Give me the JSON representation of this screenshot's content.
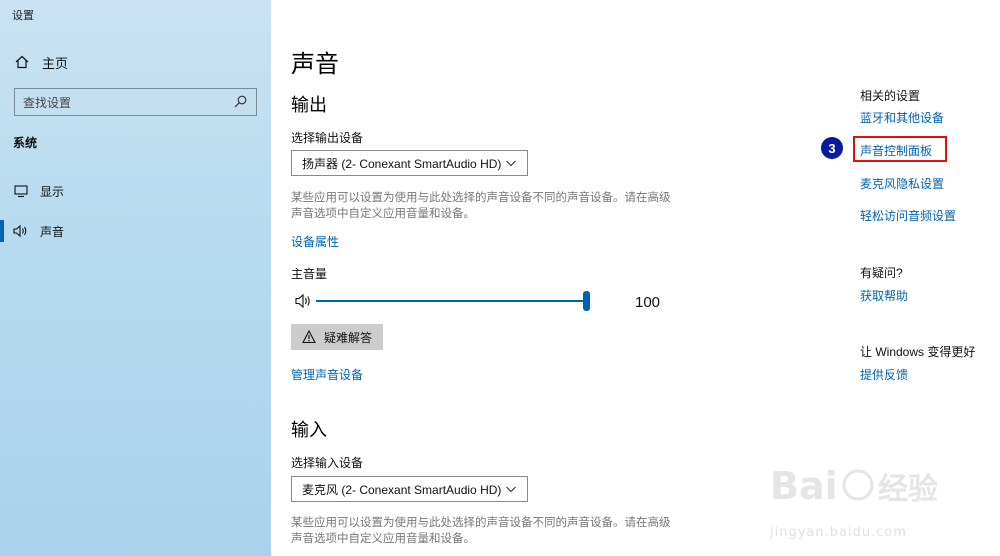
{
  "window": {
    "title": "设置"
  },
  "sidebar": {
    "home_label": "主页",
    "search_placeholder": "查找设置",
    "section": "系统",
    "items": [
      {
        "label": "显示",
        "icon": "monitor-icon",
        "active": false
      },
      {
        "label": "声音",
        "icon": "speaker-icon",
        "active": true
      }
    ]
  },
  "main": {
    "title": "声音",
    "output": {
      "heading": "输出",
      "select_label": "选择输出设备",
      "device": "扬声器 (2- Conexant SmartAudio HD)",
      "desc": "某些应用可以设置为使用与此处选择的声音设备不同的声音设备。请在高级声音选项中自定义应用音量和设备。",
      "properties_link": "设备属性",
      "volume_label": "主音量",
      "volume_value": "100",
      "volume_level": 1.0,
      "troubleshoot": "疑难解答",
      "manage_link": "管理声音设备"
    },
    "input": {
      "heading": "输入",
      "select_label": "选择输入设备",
      "device": "麦克风 (2- Conexant SmartAudio HD)",
      "desc": "某些应用可以设置为使用与此处选择的声音设备不同的声音设备。请在高级声音选项中自定义应用音量和设备。"
    }
  },
  "right": {
    "related_heading": "相关的设置",
    "related_links": [
      "蓝牙和其他设备",
      "声音控制面板",
      "麦克风隐私设置",
      "轻松访问音频设置"
    ],
    "question_heading": "有疑问?",
    "help_link": "获取帮助",
    "improve_heading": "让 Windows 变得更好",
    "feedback_link": "提供反馈"
  },
  "annotation": {
    "step": "3"
  },
  "watermark": {
    "text": "jingyan.baidu.com",
    "logo": "Baidu 经验"
  },
  "colors": {
    "accent": "#0063b1",
    "sidebar_bg": "#b8dbef",
    "highlight": "#e01010",
    "badge": "#0a1a9e"
  }
}
